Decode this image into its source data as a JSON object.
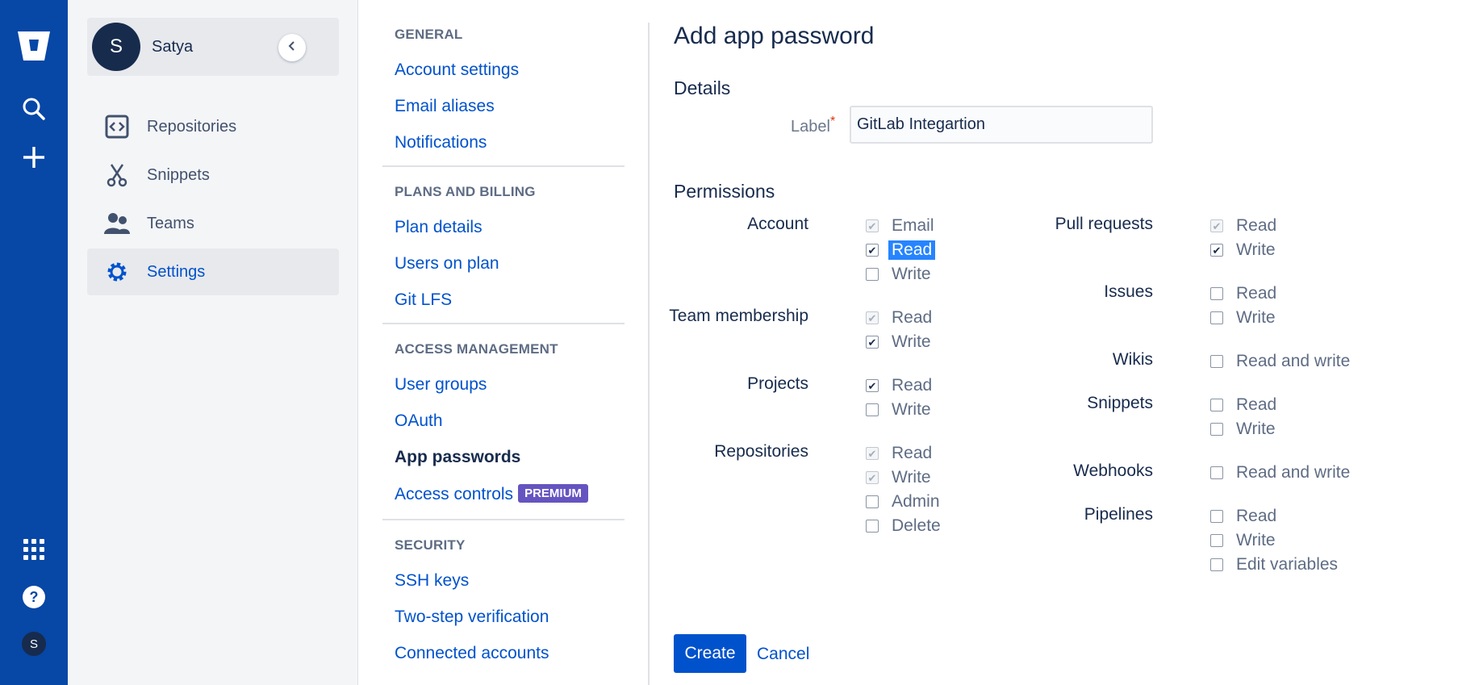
{
  "global_nav": {
    "icons": [
      "bitbucket-logo-icon",
      "search-icon",
      "plus-icon",
      "app-switcher-icon",
      "help-icon"
    ],
    "avatar_initial": "S"
  },
  "sidebar": {
    "user": {
      "initial": "S",
      "name": "Satya"
    },
    "items": [
      {
        "label": "Repositories",
        "icon": "repository-icon"
      },
      {
        "label": "Snippets",
        "icon": "snippets-scissors-icon"
      },
      {
        "label": "Teams",
        "icon": "people-icon"
      },
      {
        "label": "Settings",
        "icon": "gear-icon",
        "active": true
      }
    ]
  },
  "settings_nav": {
    "sections": [
      {
        "heading": "GENERAL",
        "links": [
          "Account settings",
          "Email aliases",
          "Notifications"
        ]
      },
      {
        "heading": "PLANS AND BILLING",
        "links": [
          "Plan details",
          "Users on plan",
          "Git LFS"
        ]
      },
      {
        "heading": "ACCESS MANAGEMENT",
        "links": [
          "User groups",
          "OAuth",
          "App passwords",
          "Access controls"
        ]
      },
      {
        "heading": "SECURITY",
        "links": [
          "SSH keys",
          "Two-step verification",
          "Connected accounts"
        ]
      }
    ],
    "current": "App passwords",
    "premium_badge": "PREMIUM"
  },
  "main": {
    "title": "Add app password",
    "details_heading": "Details",
    "label_field": {
      "label": "Label",
      "value": "GitLab Integartion"
    },
    "permissions_heading": "Permissions",
    "groups": [
      {
        "name": "Account",
        "options": [
          {
            "text": "Email",
            "checked": true,
            "disabled": true
          },
          {
            "text": "Read",
            "checked": true,
            "disabled": false,
            "highlighted": true
          },
          {
            "text": "Write",
            "checked": false,
            "disabled": false
          }
        ]
      },
      {
        "name": "Team membership",
        "options": [
          {
            "text": "Read",
            "checked": true,
            "disabled": true
          },
          {
            "text": "Write",
            "checked": true,
            "disabled": false
          }
        ]
      },
      {
        "name": "Projects",
        "options": [
          {
            "text": "Read",
            "checked": true,
            "disabled": false
          },
          {
            "text": "Write",
            "checked": false,
            "disabled": false
          }
        ]
      },
      {
        "name": "Repositories",
        "options": [
          {
            "text": "Read",
            "checked": true,
            "disabled": true
          },
          {
            "text": "Write",
            "checked": true,
            "disabled": true
          },
          {
            "text": "Admin",
            "checked": false,
            "disabled": false
          },
          {
            "text": "Delete",
            "checked": false,
            "disabled": false
          }
        ]
      },
      {
        "name": "Pull requests",
        "options": [
          {
            "text": "Read",
            "checked": true,
            "disabled": true
          },
          {
            "text": "Write",
            "checked": true,
            "disabled": false
          }
        ]
      },
      {
        "name": "Issues",
        "options": [
          {
            "text": "Read",
            "checked": false,
            "disabled": false
          },
          {
            "text": "Write",
            "checked": false,
            "disabled": false
          }
        ]
      },
      {
        "name": "Wikis",
        "options": [
          {
            "text": "Read and write",
            "checked": false,
            "disabled": false
          }
        ]
      },
      {
        "name": "Snippets",
        "options": [
          {
            "text": "Read",
            "checked": false,
            "disabled": false
          },
          {
            "text": "Write",
            "checked": false,
            "disabled": false
          }
        ]
      },
      {
        "name": "Webhooks",
        "options": [
          {
            "text": "Read and write",
            "checked": false,
            "disabled": false
          }
        ]
      },
      {
        "name": "Pipelines",
        "options": [
          {
            "text": "Read",
            "checked": false,
            "disabled": false
          },
          {
            "text": "Write",
            "checked": false,
            "disabled": false
          },
          {
            "text": "Edit variables",
            "checked": false,
            "disabled": false
          }
        ]
      }
    ],
    "create_label": "Create",
    "cancel_label": "Cancel"
  },
  "colors": {
    "global_nav_bg": "#0747a6",
    "link": "#0052cc",
    "primary_button": "#0052cc",
    "premium_badge": "#6554c0",
    "selection": "#2684ff"
  }
}
